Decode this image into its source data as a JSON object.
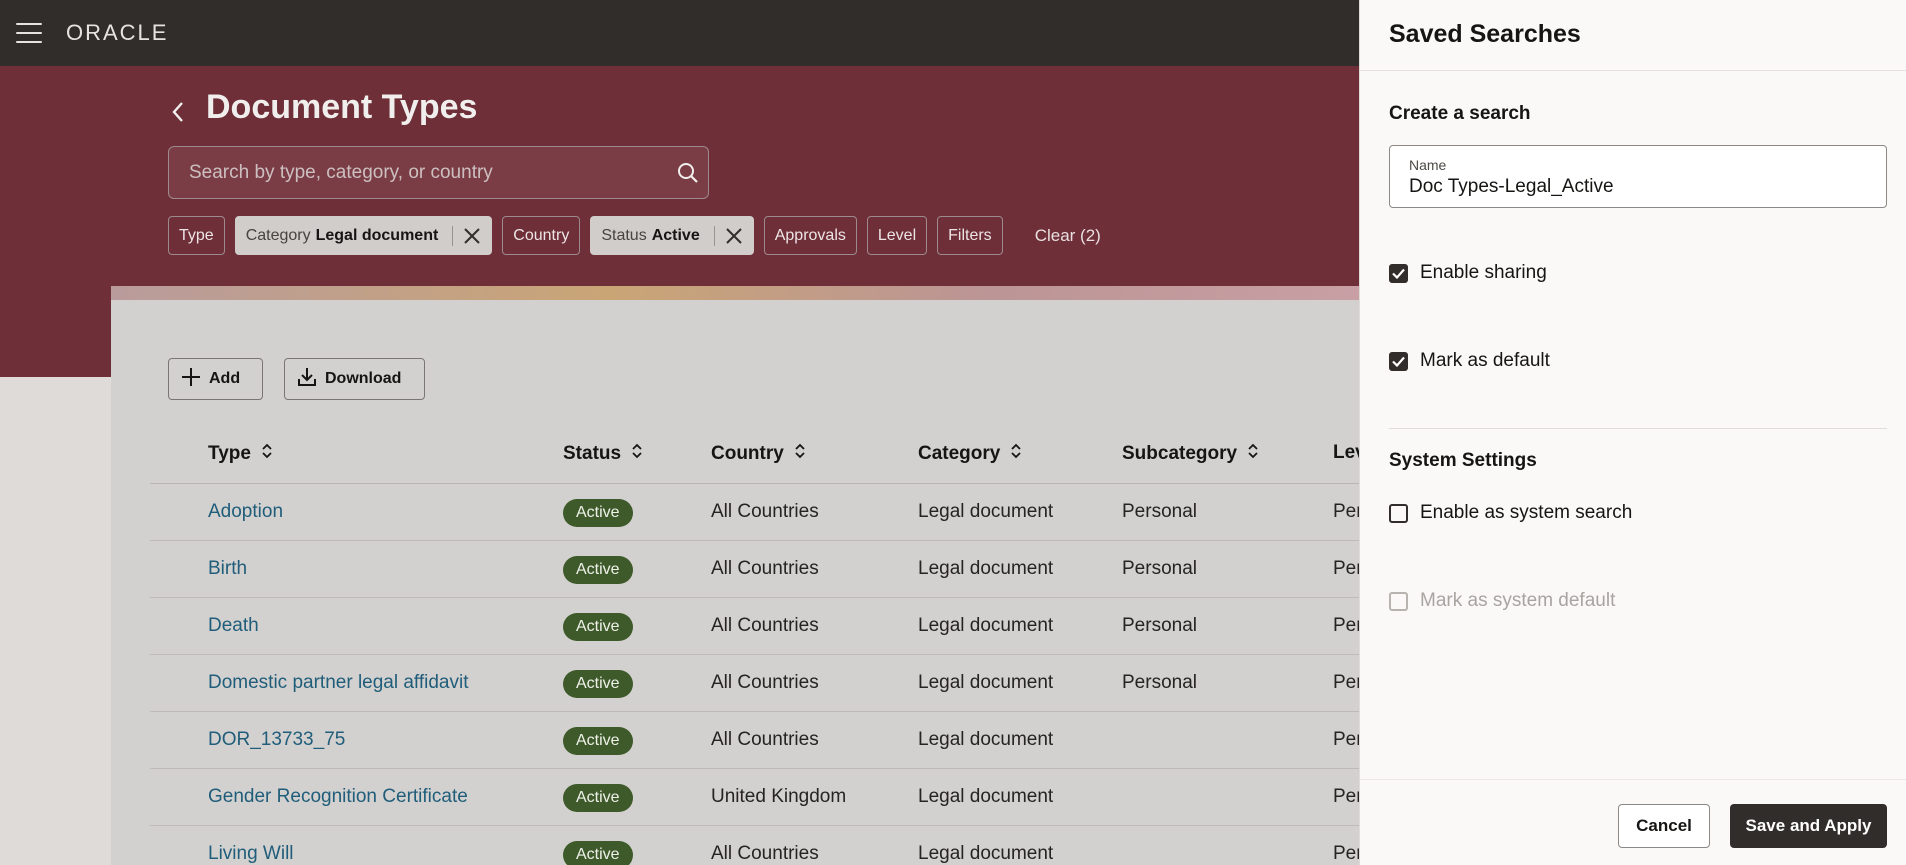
{
  "topbar": {
    "logo": "ORACLE"
  },
  "page": {
    "title": "Document Types"
  },
  "search": {
    "placeholder": "Search by type, category, or country"
  },
  "filters": {
    "chips": [
      {
        "label": "Type"
      },
      {
        "label": "Category",
        "value": "Legal document"
      },
      {
        "label": "Country"
      },
      {
        "label": "Status",
        "value": "Active"
      },
      {
        "label": "Approvals"
      },
      {
        "label": "Level"
      },
      {
        "label": "Filters"
      }
    ],
    "clear_label": "Clear (2)"
  },
  "toolbar": {
    "add_label": "Add",
    "download_label": "Download"
  },
  "table": {
    "columns": [
      "Type",
      "Status",
      "Country",
      "Category",
      "Subcategory",
      "Lev"
    ],
    "rows": [
      {
        "type": "Adoption",
        "status": "Active",
        "country": "All Countries",
        "category": "Legal document",
        "subcategory": "Personal",
        "level": "Per"
      },
      {
        "type": "Birth",
        "status": "Active",
        "country": "All Countries",
        "category": "Legal document",
        "subcategory": "Personal",
        "level": "Per"
      },
      {
        "type": "Death",
        "status": "Active",
        "country": "All Countries",
        "category": "Legal document",
        "subcategory": "Personal",
        "level": "Per"
      },
      {
        "type": "Domestic partner legal affidavit",
        "status": "Active",
        "country": "All Countries",
        "category": "Legal document",
        "subcategory": "Personal",
        "level": "Per"
      },
      {
        "type": "DOR_13733_75",
        "status": "Active",
        "country": "All Countries",
        "category": "Legal document",
        "subcategory": "",
        "level": "Per"
      },
      {
        "type": "Gender Recognition Certificate",
        "status": "Active",
        "country": "United Kingdom",
        "category": "Legal document",
        "subcategory": "",
        "level": "Per"
      },
      {
        "type": "Living Will",
        "status": "Active",
        "country": "All Countries",
        "category": "Legal document",
        "subcategory": "",
        "level": "Per"
      }
    ]
  },
  "drawer": {
    "title": "Saved Searches",
    "create_heading": "Create a search",
    "name_label": "Name",
    "name_value": "Doc Types-Legal_Active",
    "enable_sharing_label": "Enable sharing",
    "enable_sharing_checked": true,
    "mark_default_label": "Mark as default",
    "mark_default_checked": true,
    "system_heading": "System Settings",
    "system_search_label": "Enable as system search",
    "system_search_checked": false,
    "system_default_label": "Mark as system default",
    "system_default_checked": false,
    "cancel_label": "Cancel",
    "save_label": "Save and Apply"
  },
  "colors": {
    "topbar": "#312d2a",
    "hero": "#6e2f38",
    "status_badge": "#3f5a2a",
    "link": "#1f5d7a",
    "primary_button": "#312d2a"
  }
}
